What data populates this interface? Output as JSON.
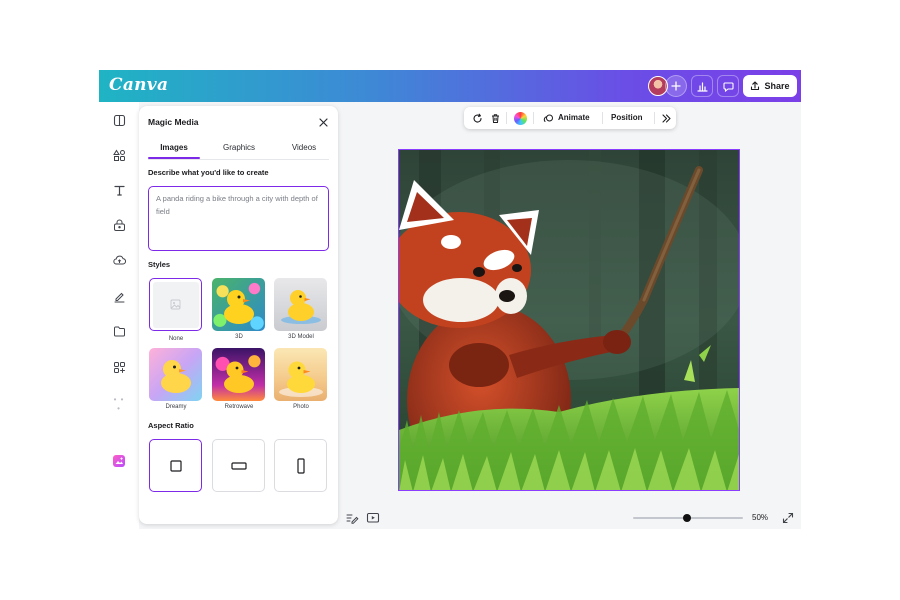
{
  "header": {
    "logo": "Canva",
    "share_label": "Share",
    "gradient_colors": [
      "#1fb4c4",
      "#6a4ee6",
      "#7b3fe8"
    ]
  },
  "rail": {
    "icons": [
      "design-icon",
      "elements-icon",
      "text-icon",
      "brand-icon",
      "uploads-icon",
      "draw-icon",
      "projects-icon",
      "apps-icon"
    ],
    "active_app_icon": "magic-media-icon",
    "bottom_icon": "magic-sparkle-icon"
  },
  "panel": {
    "title": "Magic Media",
    "tabs": [
      {
        "label": "Images",
        "active": true
      },
      {
        "label": "Graphics",
        "active": false
      },
      {
        "label": "Videos",
        "active": false
      }
    ],
    "describe_label": "Describe what you'd like to create",
    "prompt_placeholder": "A panda riding a bike through a city with depth of field",
    "styles_label": "Styles",
    "styles": [
      {
        "label": "None",
        "selected": true
      },
      {
        "label": "3D",
        "selected": false
      },
      {
        "label": "3D Model",
        "selected": false
      },
      {
        "label": "Dreamy",
        "selected": false
      },
      {
        "label": "Retrowave",
        "selected": false
      },
      {
        "label": "Photo",
        "selected": false
      }
    ],
    "aspect_label": "Aspect Ratio",
    "aspect_ratios": [
      {
        "name": "square",
        "selected": true
      },
      {
        "name": "landscape",
        "selected": false
      },
      {
        "name": "portrait",
        "selected": false
      }
    ]
  },
  "toolbar": {
    "animate_label": "Animate",
    "position_label": "Position"
  },
  "canvas": {
    "image": "red-panda-with-stick-in-grass",
    "selection_color": "#8b3dff"
  },
  "footer": {
    "zoom_label": "50%",
    "zoom_fraction": 0.5
  },
  "colors": {
    "accent": "#7d2ae8"
  }
}
